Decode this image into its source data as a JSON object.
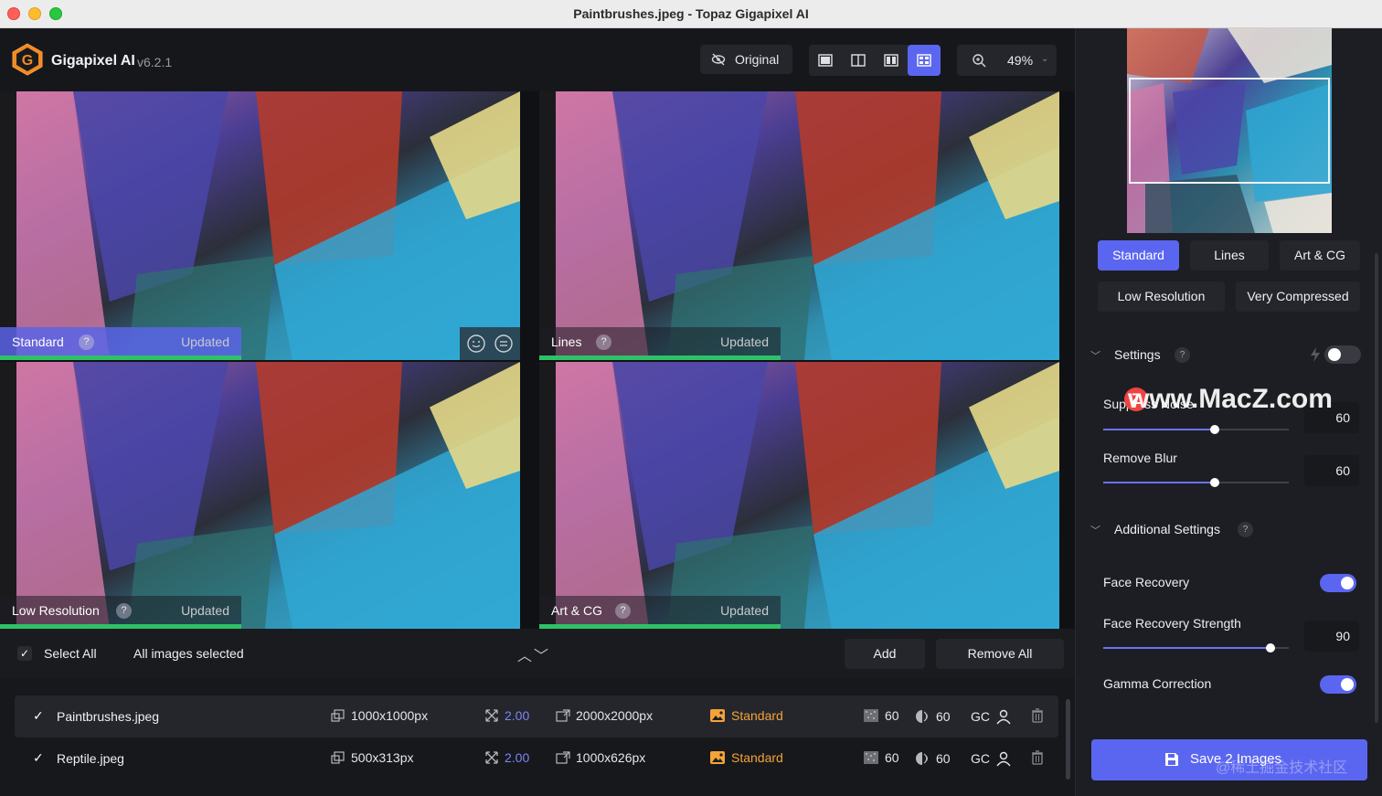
{
  "window": {
    "title": "Paintbrushes.jpeg - Topaz Gigapixel AI"
  },
  "app": {
    "name": "Gigapixel AI",
    "version": "v6.2.1",
    "logo_letter": "G",
    "accent": "#5b66f0"
  },
  "toolbar": {
    "original_label": "Original",
    "zoom_value": "49%",
    "view_modes": [
      "single-view",
      "split-view",
      "side-by-side-view",
      "grid-view"
    ],
    "active_view": "grid-view"
  },
  "panes": [
    {
      "name": "Standard",
      "status": "Updated",
      "active": true
    },
    {
      "name": "Lines",
      "status": "Updated",
      "active": false
    },
    {
      "name": "Low Resolution",
      "status": "Updated",
      "active": false
    },
    {
      "name": "Art & CG",
      "status": "Updated",
      "active": false
    }
  ],
  "selection": {
    "select_all_label": "Select All",
    "info": "All images selected",
    "add_label": "Add",
    "remove_all_label": "Remove All"
  },
  "files": [
    {
      "name": "Paintbrushes.jpeg",
      "input_size": "1000x1000px",
      "scale": "2.00",
      "output_size": "2000x2000px",
      "model": "Standard",
      "noise": "60",
      "blur": "60",
      "gc": "GC"
    },
    {
      "name": "Reptile.jpeg",
      "input_size": "500x313px",
      "scale": "2.00",
      "output_size": "1000x626px",
      "model": "Standard",
      "noise": "60",
      "blur": "60",
      "gc": "GC"
    }
  ],
  "right_panel": {
    "models": [
      "Standard",
      "Lines",
      "Art & CG",
      "Low Resolution",
      "Very Compressed"
    ],
    "active_model": "Standard",
    "settings": {
      "title": "Settings",
      "help": "?",
      "suppress_noise_label": "Suppress Noise",
      "suppress_noise_value": "60",
      "suppress_noise_level": 0.6,
      "remove_blur_label": "Remove Blur",
      "remove_blur_value": "60",
      "remove_blur_level": 0.6
    },
    "additional": {
      "title": "Additional Settings",
      "help": "?",
      "face_recovery_label": "Face Recovery",
      "face_recovery_on": true,
      "face_recovery_strength_label": "Face Recovery Strength",
      "face_recovery_strength_value": "90",
      "face_recovery_strength_level": 0.9,
      "gamma_correction_label": "Gamma Correction",
      "gamma_correction_on": true
    },
    "save_label": "Save 2 Images"
  },
  "watermark": {
    "text": "www.MacZ.com",
    "badge": "Z",
    "text2": "@稀土掘金技术社区"
  }
}
